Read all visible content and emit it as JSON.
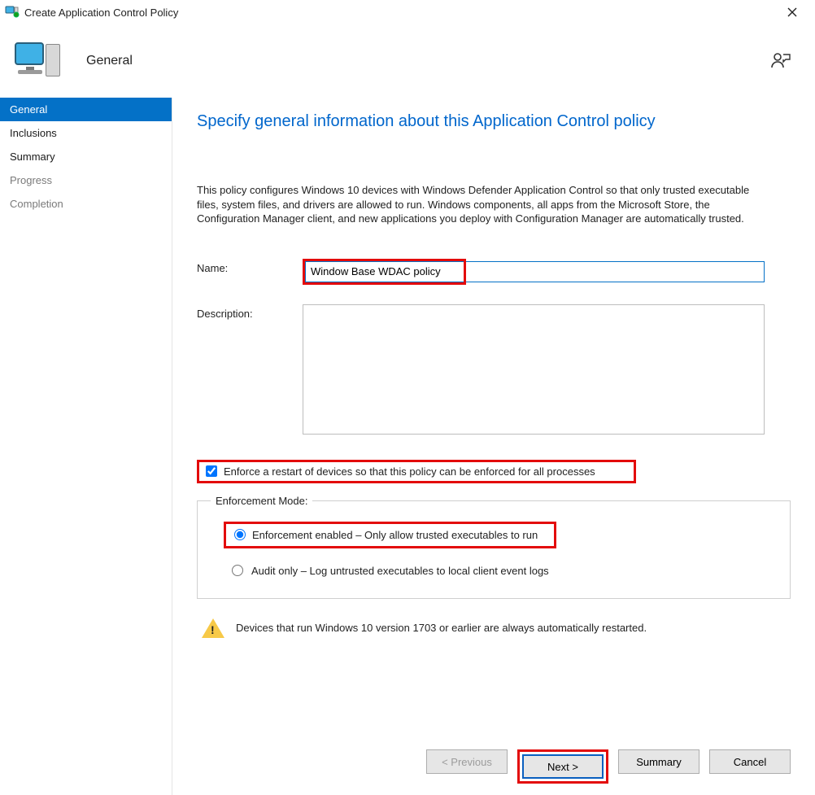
{
  "window": {
    "title": "Create Application Control Policy"
  },
  "header": {
    "section": "General"
  },
  "nav": {
    "items": [
      {
        "label": "General",
        "active": true,
        "dim": false
      },
      {
        "label": "Inclusions",
        "active": false,
        "dim": false
      },
      {
        "label": "Summary",
        "active": false,
        "dim": false
      },
      {
        "label": "Progress",
        "active": false,
        "dim": true
      },
      {
        "label": "Completion",
        "active": false,
        "dim": true
      }
    ]
  },
  "page": {
    "heading": "Specify general information about this Application Control policy",
    "intro": "This policy configures Windows 10 devices with Windows Defender Application Control so that only trusted executable files, system files, and drivers are allowed to run. Windows components, all apps from the Microsoft Store, the Configuration Manager client, and new applications you deploy with Configuration Manager are automatically trusted.",
    "name_label": "Name:",
    "name_value": "Window Base WDAC policy",
    "description_label": "Description:",
    "description_value": "",
    "enforce_restart_label": "Enforce a restart of devices so that this policy can be enforced for all processes",
    "enforce_restart_checked": true,
    "enforcement_legend": "Enforcement Mode:",
    "radio_enforce_label": "Enforcement enabled – Only allow trusted executables to run",
    "radio_audit_label": "Audit only – Log untrusted executables to local client event logs",
    "enforcement_selected": "enforce",
    "warning": "Devices that run Windows 10 version 1703 or earlier are always automatically restarted."
  },
  "buttons": {
    "previous": "< Previous",
    "next": "Next >",
    "summary": "Summary",
    "cancel": "Cancel"
  }
}
